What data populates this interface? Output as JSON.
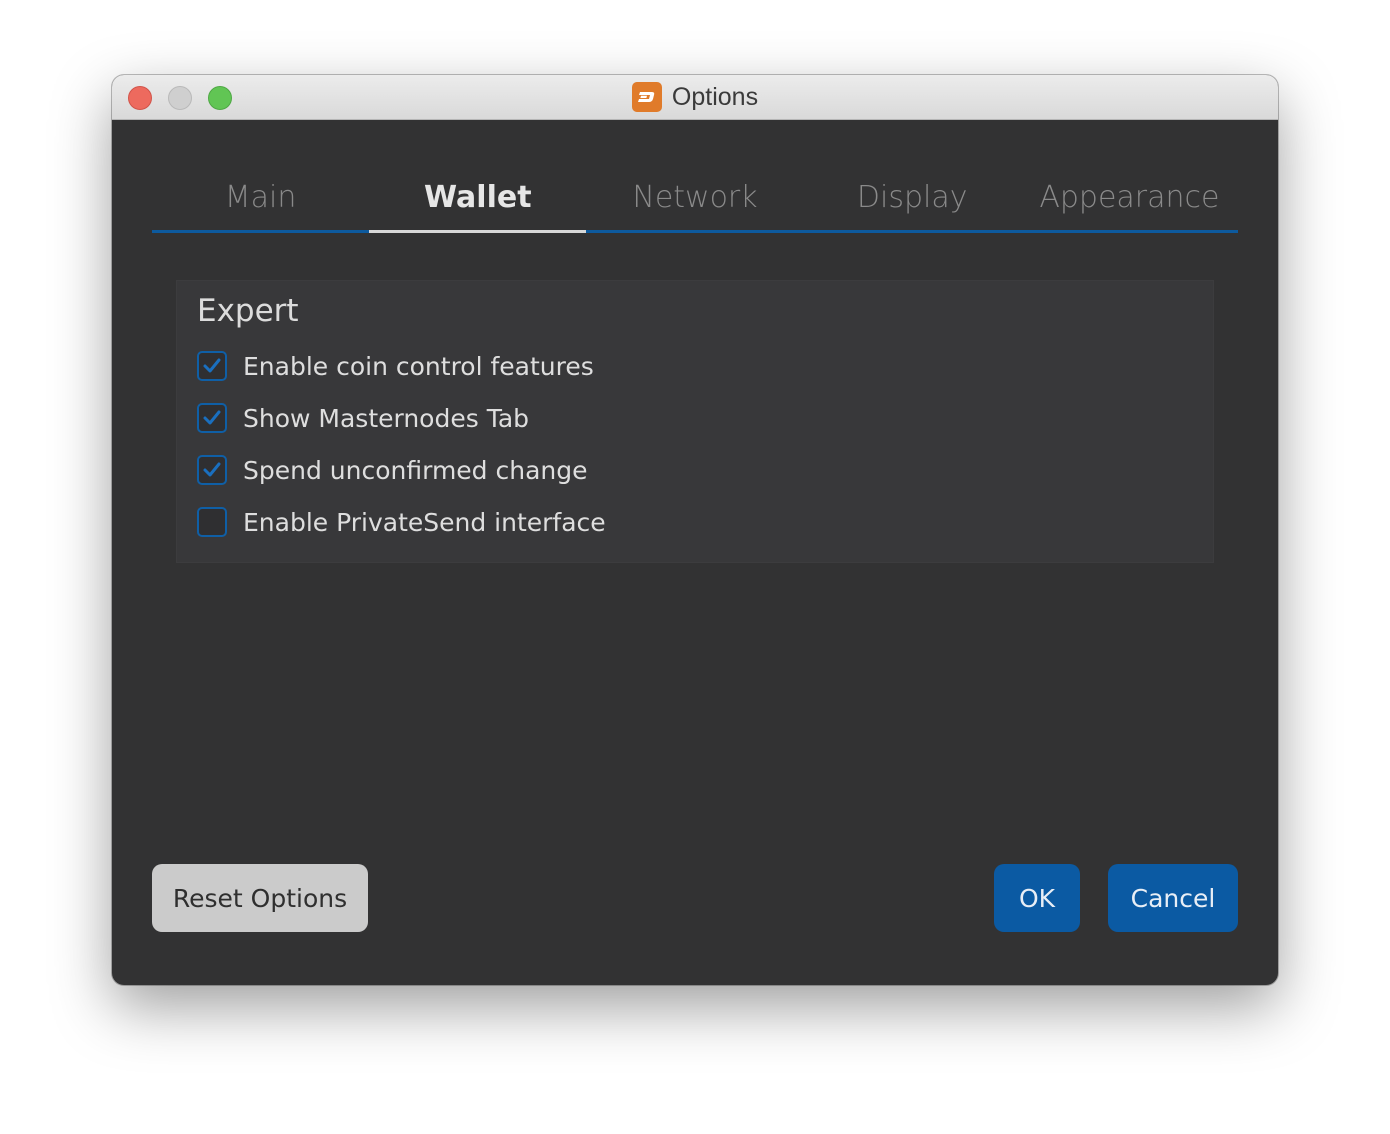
{
  "window": {
    "title": "Options",
    "accent_color": "#0b5aa3",
    "app_icon": "dash-logo-icon"
  },
  "tabs": [
    {
      "label": "Main",
      "active": false
    },
    {
      "label": "Wallet",
      "active": true
    },
    {
      "label": "Network",
      "active": false
    },
    {
      "label": "Display",
      "active": false
    },
    {
      "label": "Appearance",
      "active": false
    }
  ],
  "expert": {
    "title": "Expert",
    "options": [
      {
        "label": "Enable coin control features",
        "checked": true
      },
      {
        "label": "Show Masternodes Tab",
        "checked": true
      },
      {
        "label": "Spend unconfirmed change",
        "checked": true
      },
      {
        "label": "Enable PrivateSend interface",
        "checked": false
      }
    ]
  },
  "buttons": {
    "reset": "Reset Options",
    "ok": "OK",
    "cancel": "Cancel"
  }
}
